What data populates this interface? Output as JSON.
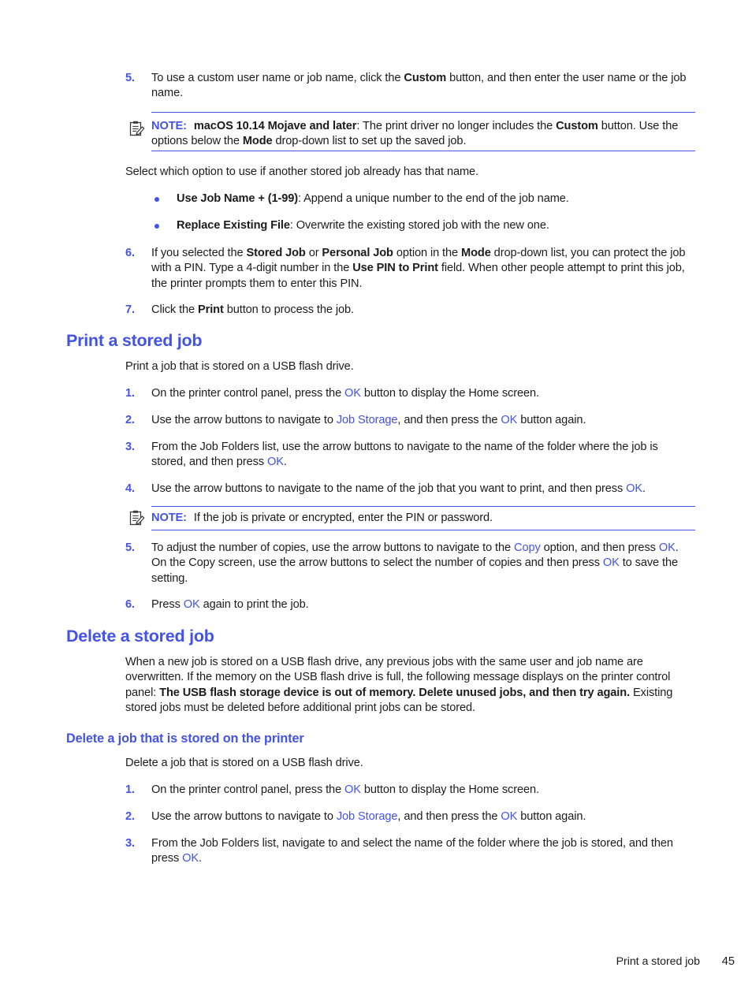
{
  "document": {
    "footer_title": "Print a stored job",
    "page_number": "45",
    "accent_color": "#4353E8",
    "text_color": "#1c1c1c"
  },
  "steps_top": {
    "step5": {
      "num": "5.",
      "t1": "To use a custom user name or job name, click the ",
      "b1": "Custom",
      "t2": " button, and then enter the user name or the job name."
    },
    "note1": {
      "icon": "note-clipboard-icon",
      "label": "NOTE:",
      "b1": "macOS 10.14 Mojave and later",
      "t1": ": The print driver no longer includes the ",
      "b2": "Custom",
      "t2": " button. Use the options below the ",
      "b3": "Mode",
      "t3": " drop-down list to set up the saved job."
    },
    "intro": "Select which option to use if another stored job already has that name.",
    "bullets": [
      {
        "bold": "Use Job Name + (1-99)",
        "rest": ": Append a unique number to the end of the job name."
      },
      {
        "bold": "Replace Existing File",
        "rest": ": Overwrite the existing stored job with the new one."
      }
    ],
    "step6": {
      "num": "6.",
      "t1": "If you selected the ",
      "b1": "Stored Job",
      "t2": " or ",
      "b2": "Personal Job",
      "t3": " option in the ",
      "b3": "Mode",
      "t4": " drop-down list, you can protect the job with a PIN. Type a 4-digit number in the ",
      "b4": "Use PIN to Print",
      "t5": " field. When other people attempt to print this job, the printer prompts them to enter this PIN."
    },
    "step7": {
      "num": "7.",
      "t1": "Click the ",
      "b1": "Print",
      "t2": " button to process the job."
    }
  },
  "print_stored_job": {
    "heading": "Print a stored job",
    "intro": "Print a job that is stored on a USB flash drive.",
    "step1": {
      "num": "1.",
      "t1": "On the printer control panel, press the ",
      "ui1": "OK",
      "t2": " button to display the Home screen."
    },
    "step2": {
      "num": "2.",
      "t1": "Use the arrow buttons to navigate to ",
      "ui1": "Job Storage",
      "t2": ", and then press the ",
      "ui2": "OK",
      "t3": " button again."
    },
    "step3": {
      "num": "3.",
      "t1": "From the Job Folders list, use the arrow buttons to navigate to the name of the folder where the job is stored, and then press ",
      "ui1": "OK",
      "t2": "."
    },
    "step4": {
      "num": "4.",
      "t1": "Use the arrow buttons to navigate to the name of the job that you want to print, and then press ",
      "ui1": "OK",
      "t2": "."
    },
    "note2": {
      "icon": "note-clipboard-icon",
      "label": "NOTE:",
      "text": "If the job is private or encrypted, enter the PIN or password."
    },
    "step5": {
      "num": "5.",
      "t1": "To adjust the number of copies, use the arrow buttons to navigate to the ",
      "ui1": "Copy",
      "t2": " option, and then press ",
      "ui2": "OK",
      "t3": ". On the Copy screen, use the arrow buttons to select the number of copies and then press ",
      "ui3": "OK",
      "t4": " to save the setting."
    },
    "step6": {
      "num": "6.",
      "t1": "Press ",
      "ui1": "OK",
      "t2": " again to print the job."
    }
  },
  "delete_stored_job": {
    "heading": "Delete a stored job",
    "para": {
      "t1": "When a new job is stored on a USB flash drive, any previous jobs with the same user and job name are overwritten. If the memory on the USB flash drive is full, the following message displays on the printer control panel: ",
      "b1": "The USB flash storage device is out of memory. Delete unused jobs, and then try again.",
      "t2": " Existing stored jobs must be deleted before additional print jobs can be stored."
    },
    "subheading": "Delete a job that is stored on the printer",
    "intro": "Delete a job that is stored on a USB flash drive.",
    "step1": {
      "num": "1.",
      "t1": "On the printer control panel, press the ",
      "ui1": "OK",
      "t2": " button to display the Home screen."
    },
    "step2": {
      "num": "2.",
      "t1": "Use the arrow buttons to navigate to ",
      "ui1": "Job Storage",
      "t2": ", and then press the ",
      "ui2": "OK",
      "t3": " button again."
    },
    "step3": {
      "num": "3.",
      "t1": "From the Job Folders list, navigate to and select the name of the folder where the job is stored, and then press ",
      "ui1": "OK",
      "t2": "."
    }
  }
}
